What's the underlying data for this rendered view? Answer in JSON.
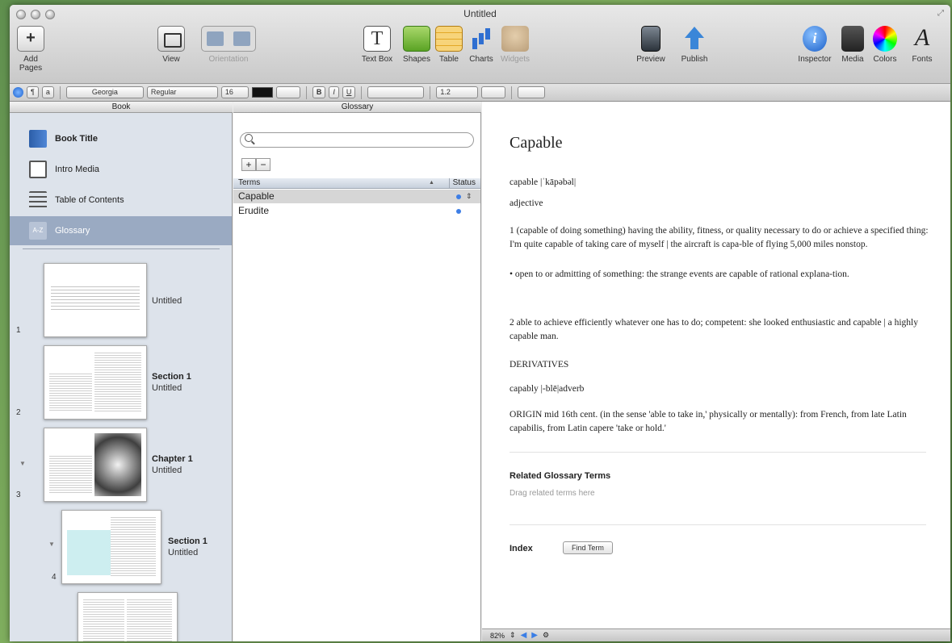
{
  "window": {
    "title": "Untitled"
  },
  "toolbar": {
    "add_pages": "Add Pages",
    "view": "View",
    "orientation": "Orientation",
    "text_box": "Text Box",
    "text_box_glyph": "T",
    "shapes": "Shapes",
    "table": "Table",
    "charts": "Charts",
    "widgets": "Widgets",
    "preview": "Preview",
    "publish": "Publish",
    "inspector": "Inspector",
    "inspector_glyph": "i",
    "media": "Media",
    "colors": "Colors",
    "fonts": "Fonts",
    "fonts_glyph": "A",
    "add_glyph": "+"
  },
  "format_bar": {
    "paragraph_style": "¶",
    "char_style": "a",
    "font_family": "Georgia",
    "font_style": "Regular",
    "font_size": "16",
    "bold": "B",
    "italic": "I",
    "underline": "U",
    "line_spacing": "1.2",
    "color": "#111111"
  },
  "sidebar": {
    "header": "Book",
    "items": [
      {
        "label": "Book Title",
        "icon": "book-icon"
      },
      {
        "label": "Intro Media",
        "icon": "intro-media-icon"
      },
      {
        "label": "Table of Contents",
        "icon": "toc-icon"
      },
      {
        "label": "Glossary",
        "icon": "glossary-icon",
        "badge": "A-Z",
        "selected": true
      }
    ],
    "pages": [
      {
        "num": "1",
        "title": "",
        "subtitle": "Untitled"
      },
      {
        "num": "2",
        "title": "Section 1",
        "subtitle": "Untitled"
      },
      {
        "num": "3",
        "title": "Chapter 1",
        "subtitle": "Untitled"
      },
      {
        "num": "4",
        "title": "Section 1",
        "subtitle": "Untitled"
      }
    ]
  },
  "glossary": {
    "header": "Glossary",
    "search_placeholder": "",
    "add_glyph": "+",
    "remove_glyph": "−",
    "columns": {
      "terms": "Terms",
      "status": "Status"
    },
    "terms": [
      {
        "term": "Capable",
        "selected": true
      },
      {
        "term": "Erudite",
        "selected": false
      }
    ]
  },
  "entry": {
    "title": "Capable",
    "pronunciation": "capable |ˈkāpəbəl|",
    "pos": "adjective",
    "def1": "1 (capable of doing something) having the ability, fitness, or quality necessary to do or achieve a specified thing: I'm quite capable of taking care of myself | the aircraft is capa-ble of flying 5,000 miles nonstop.",
    "def1b": "• open to or admitting of something: the strange events are capable of rational explana-tion.",
    "def2": "2 able to achieve efficiently whatever one has to do; competent: she looked enthusiastic and capable | a highly capable man.",
    "derivatives": "DERIVATIVES",
    "capably": "capably |-blē|adverb",
    "origin": "ORIGIN mid 16th cent. (in the sense 'able to take in,' physically or mentally): from French, from late Latin capabilis, from Latin capere 'take or hold.'",
    "related_title": "Related Glossary Terms",
    "related_hint": "Drag related terms here",
    "index_label": "Index",
    "find_term": "Find Term"
  },
  "status_bar": {
    "zoom": "82%"
  }
}
